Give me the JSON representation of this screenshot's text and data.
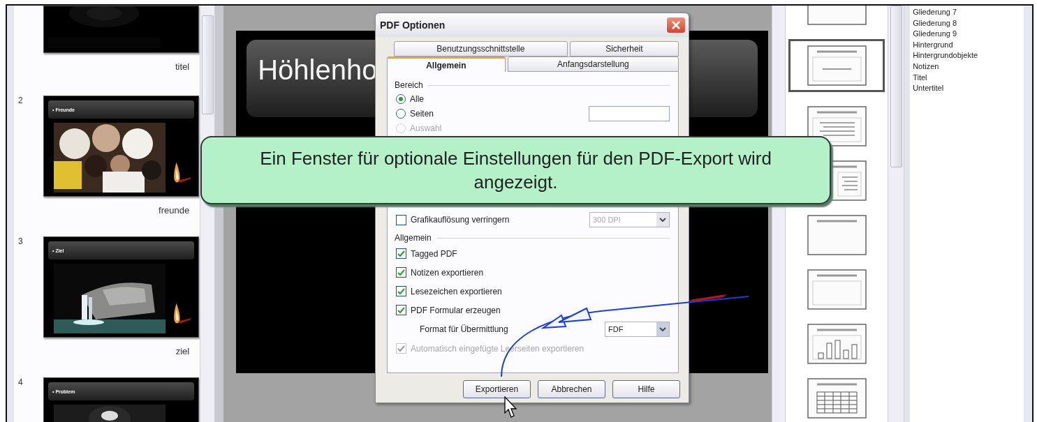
{
  "slide_panel": {
    "slides": [
      {
        "kind": "title",
        "name": "titel"
      },
      {
        "kind": "people",
        "number": "2",
        "heading": "• Freunde",
        "name": "freunde"
      },
      {
        "kind": "cave",
        "number": "3",
        "heading": "• Ziel",
        "name": "ziel"
      },
      {
        "kind": "glow",
        "number": "4",
        "heading": "• Problem"
      }
    ]
  },
  "main_slide": {
    "title": "Höhlenho"
  },
  "dialog": {
    "title": "PDF Optionen",
    "tab_rows": [
      {
        "tabs": [
          {
            "label": "Benutzungsschnittstelle",
            "selected": false
          },
          {
            "label": "Sicherheit",
            "selected": false
          }
        ]
      },
      {
        "tabs": [
          {
            "label": "Allgemein",
            "selected": true
          },
          {
            "label": "Anfangsdarstellung",
            "selected": false
          }
        ]
      }
    ],
    "range": {
      "heading": "Bereich",
      "options": [
        {
          "label": "Alle",
          "selected": true,
          "disabled": false
        },
        {
          "label": "Seiten",
          "selected": false,
          "disabled": false
        },
        {
          "label": "Auswahl",
          "selected": false,
          "disabled": true
        }
      ]
    },
    "image": {
      "label": "Grafikauflösung verringern",
      "checked": false,
      "resolution": "300 DPI",
      "resolution_disabled": true
    },
    "general": {
      "heading": "Allgemein",
      "options": [
        {
          "kind": "checkbox",
          "label": "Tagged PDF",
          "checked": true,
          "disabled": false
        },
        {
          "kind": "checkbox",
          "label": "Notizen exportieren",
          "checked": true,
          "disabled": false
        },
        {
          "kind": "checkbox",
          "label": "Lesezeichen exportieren",
          "checked": true,
          "disabled": false
        },
        {
          "kind": "checkbox",
          "label": "PDF Formular erzeugen",
          "checked": true,
          "disabled": false
        },
        {
          "kind": "select",
          "label": "Format für Übermittlung",
          "value": "FDF"
        },
        {
          "kind": "checkbox",
          "label": "Automatisch eingefügte Leerseiten exportieren",
          "checked": true,
          "disabled": true
        }
      ]
    },
    "buttons": [
      {
        "label": "Exportieren"
      },
      {
        "label": "Abbrechen"
      },
      {
        "label": "Hilfe"
      }
    ]
  },
  "layouts": [
    {
      "kind": "blank",
      "selected": false
    },
    {
      "kind": "title-content",
      "selected": true
    },
    {
      "kind": "title-bullets",
      "selected": false
    },
    {
      "kind": "title-side-bullets",
      "selected": false
    },
    {
      "kind": "title-only",
      "selected": false
    },
    {
      "kind": "title-box",
      "selected": false
    },
    {
      "kind": "title-chart",
      "selected": false
    },
    {
      "kind": "title-table",
      "selected": false
    }
  ],
  "styles": [
    "Gliederung 7",
    "Gliederung 8",
    "Gliederung 9",
    "Hintergrund",
    "Hintergrundobjekte",
    "Notizen",
    "Titel",
    "Untertitel"
  ],
  "callout": {
    "text": "Ein Fenster für optionale Einstellungen für den PDF-Export wird angezeigt."
  }
}
